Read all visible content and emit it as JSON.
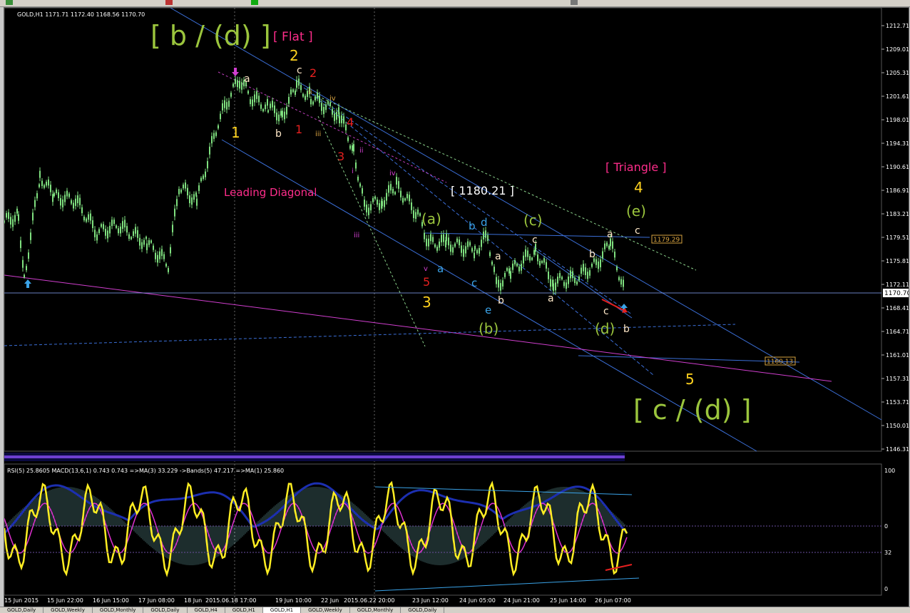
{
  "toolbar": {
    "icons": [
      "arrow-icon",
      "cross-icon",
      "green-plus-icon",
      "gear-icon"
    ]
  },
  "chart": {
    "symbol_info": "GOLD,H1  1171.71 1172.40 1168.56 1170.70",
    "price_axis": [
      "1212.71",
      "1209.01",
      "1205.31",
      "1201.61",
      "1198.01",
      "1194.31",
      "1190.61",
      "1186.91",
      "1183.21",
      "1179.51",
      "1175.81",
      "1172.11",
      "1168.41",
      "1164.71",
      "1161.01",
      "1157.31",
      "1153.71",
      "1150.01",
      "1146.31"
    ],
    "time_axis": [
      "15 Jun 2015",
      "15 Jun 22:00",
      "16 Jun 15:00",
      "17 Jun 08:00",
      "18 Jun",
      "2015.06.18 17:00",
      "19 Jun 10:00",
      "22 Jun",
      "2015.06.22 20:00",
      "23 Jun 12:00",
      "24 Jun 05:00",
      "24 Jun 21:00",
      "25 Jun 14:00",
      "26 Jun 07:00"
    ],
    "current_price": "1170.70",
    "level_1179": "1179.29",
    "level_1160": "1160.13",
    "labels": {
      "b_d": "[ b / (d) ]",
      "flat": "[ Flat ]",
      "leading_diagonal": "Leading Diagonal",
      "price_1180": "[ 1180.21 ]",
      "triangle": "[ Triangle ]",
      "c_d": "[ c / (d) ]",
      "w2": "2",
      "w1": "1",
      "w3": "3",
      "w4": "4",
      "w5": "5",
      "a": "a",
      "b": "b",
      "c": "c",
      "d": "d",
      "e": "e",
      "r1": "1",
      "r2": "2",
      "r3": "3",
      "r4": "4",
      "r5": "5",
      "ii": "ii",
      "iii": "iii",
      "iv": "iv",
      "v": "v",
      "i": "i",
      "pa": "(a)",
      "pb": "(b)",
      "pc": "(c)",
      "pd": "(d)",
      "pe": "(e)"
    }
  },
  "indicator": {
    "header": "RSI(5) 25.8605  MACD(13,6,1) 0.743 0.743  =>MA(3) 33.229  ->Bands(5) 47.217  =>MA(1) 25.860",
    "scale": [
      "100",
      "0",
      "32",
      "0"
    ]
  },
  "tabs": [
    "GOLD,Daily",
    "GOLD,Weekly",
    "GOLD,Monthly",
    "GOLD,Daily",
    "GOLD,H4",
    "GOLD,H1",
    "GOLD,H1",
    "GOLD,Weekly",
    "GOLD,Monthly",
    "GOLD,Daily"
  ],
  "active_tab": 6
}
